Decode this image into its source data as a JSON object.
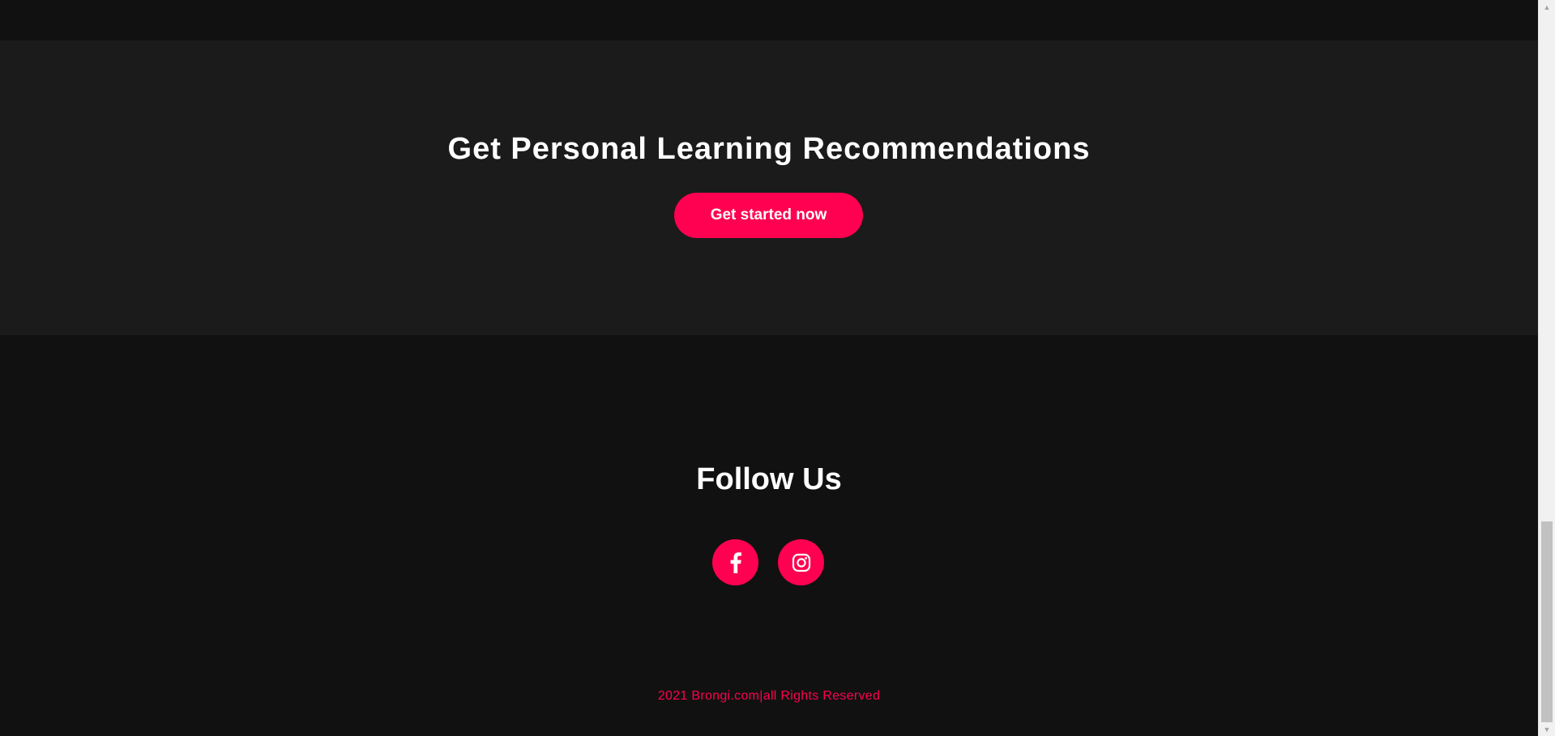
{
  "cta": {
    "heading": "Get Personal Learning Recommendations",
    "button_label": "Get started now"
  },
  "follow": {
    "heading": "Follow Us",
    "socials": [
      {
        "icon": "facebook-icon"
      },
      {
        "icon": "instagram-icon"
      }
    ]
  },
  "footer": {
    "copyright": "2021 Brongi.com|all Rights Reserved"
  },
  "scrollbar": {
    "up_glyph": "▲",
    "down_glyph": "▼"
  },
  "colors": {
    "accent": "#ff0150",
    "section_dark": "#111111",
    "section_mid": "#1b1b1b",
    "text": "#ffffff"
  }
}
